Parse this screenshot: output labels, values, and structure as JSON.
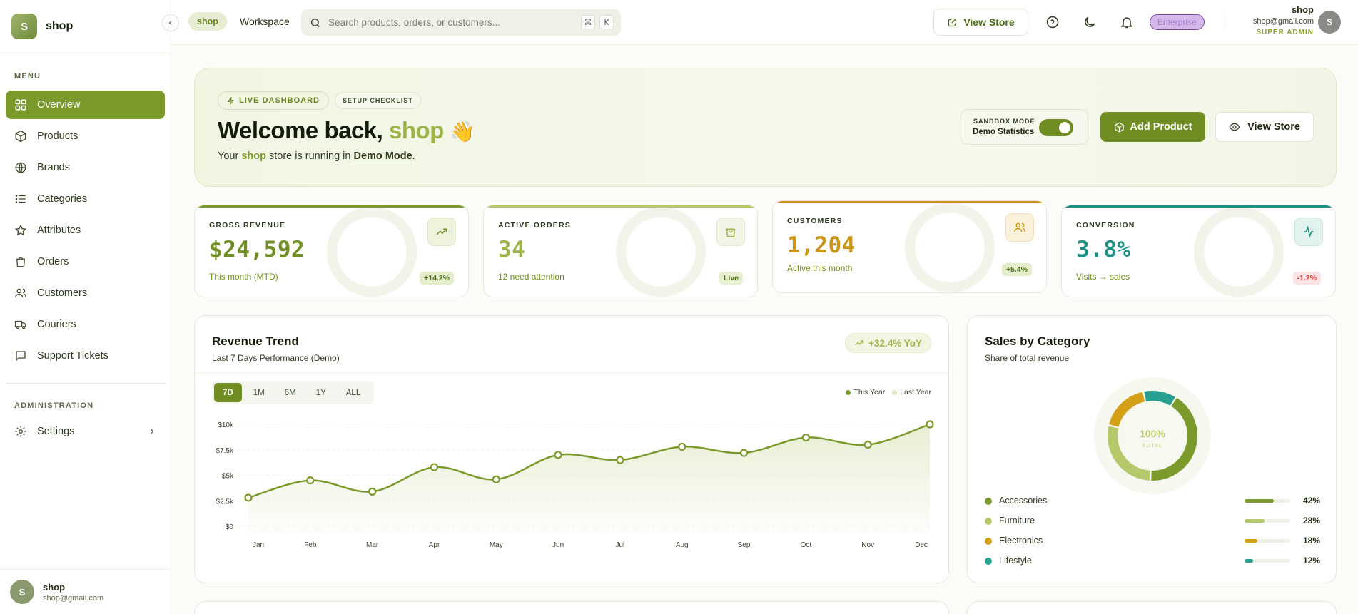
{
  "sidebar": {
    "brand": {
      "initial": "S",
      "name": "shop"
    },
    "menu_title": "MENU",
    "items": [
      {
        "label": "Overview",
        "icon": "grid-icon",
        "active": true
      },
      {
        "label": "Products",
        "icon": "box-icon"
      },
      {
        "label": "Brands",
        "icon": "globe-icon"
      },
      {
        "label": "Categories",
        "icon": "list-icon"
      },
      {
        "label": "Attributes",
        "icon": "star-icon"
      },
      {
        "label": "Orders",
        "icon": "bag-icon"
      },
      {
        "label": "Customers",
        "icon": "users-icon"
      },
      {
        "label": "Couriers",
        "icon": "truck-icon"
      },
      {
        "label": "Support Tickets",
        "icon": "message-icon"
      }
    ],
    "admin_title": "ADMINISTRATION",
    "settings_label": "Settings",
    "user": {
      "initial": "S",
      "name": "shop",
      "email": "shop@gmail.com"
    }
  },
  "topbar": {
    "shop_pill": "shop",
    "workspace": "Workspace",
    "search_placeholder": "Search products, orders, or customers...",
    "kbd_cmd": "⌘",
    "kbd_k": "K",
    "view_store": "View Store",
    "plan_badge": "Enterprise",
    "user": {
      "name": "shop",
      "email": "shop@gmail.com",
      "role": "SUPER ADMIN",
      "initial": "S"
    }
  },
  "hero": {
    "badge_live": "LIVE DASHBOARD",
    "badge_setup": "SETUP CHECKLIST",
    "title_prefix": "Welcome back,",
    "title_name": "shop",
    "title_emoji": "👋",
    "sub_prefix": "Your",
    "sub_shop": "shop",
    "sub_mid": "store is running in",
    "sub_mode": "Demo Mode",
    "sub_suffix": ".",
    "sandbox_label": "SANDBOX MODE",
    "sandbox_value": "Demo Statistics",
    "sandbox_on": true,
    "add_product": "Add Product",
    "view_store": "View Store"
  },
  "stats": [
    {
      "label": "GROSS REVENUE",
      "value": "$24,592",
      "footer": "This month (MTD)",
      "chip": "+14.2%",
      "icon": "trending-up-icon",
      "accent": "#7a9a2b"
    },
    {
      "label": "ACTIVE ORDERS",
      "value": "34",
      "footer": "12 need attention",
      "chip": "Live",
      "icon": "shopping-bag-icon",
      "accent": "#9bb347"
    },
    {
      "label": "CUSTOMERS",
      "value": "1,204",
      "footer": "Active this month",
      "chip": "+5.4%",
      "icon": "users-icon",
      "accent": "#c9961a"
    },
    {
      "label": "CONVERSION",
      "value": "3.8%",
      "footer": "Visits → sales",
      "chip": "-1.2%",
      "icon": "activity-icon",
      "accent": "#1f8f82"
    }
  ],
  "revenue": {
    "title": "Revenue Trend",
    "subtitle": "Last 7 Days Performance (Demo)",
    "yoy": "+32.4% YoY",
    "tabs": [
      "7D",
      "1M",
      "6M",
      "1Y",
      "ALL"
    ],
    "active_tab": "7D",
    "legend_this": "This Year",
    "legend_last": "Last Year"
  },
  "category": {
    "title": "Sales by Category",
    "subtitle": "Share of total revenue",
    "center_value": "100%",
    "center_label": "TOTAL"
  },
  "chart_data": [
    {
      "type": "area",
      "categories": [
        "Jan",
        "Feb",
        "Mar",
        "Apr",
        "May",
        "Jun",
        "Jul",
        "Aug",
        "Sep",
        "Oct",
        "Nov",
        "Dec"
      ],
      "series": [
        {
          "name": "This Year",
          "values": [
            2800,
            4500,
            3400,
            5800,
            4600,
            7000,
            6500,
            7800,
            7200,
            8700,
            8000,
            10000
          ]
        }
      ],
      "yticks": [
        "$0",
        "$2.5k",
        "$5k",
        "$7.5k",
        "$10k"
      ],
      "ylim": [
        0,
        10000
      ],
      "colors": {
        "line": "#7a9a2b",
        "area": "#e8eed3"
      }
    },
    {
      "type": "pie",
      "categories": [
        "Accessories",
        "Furniture",
        "Electronics",
        "Lifestyle"
      ],
      "values": [
        42,
        28,
        18,
        12
      ],
      "labels": [
        "42%",
        "28%",
        "18%",
        "12%"
      ],
      "colors": [
        "#7a9a2b",
        "#b6c96a",
        "#d4a017",
        "#27a08f"
      ]
    }
  ]
}
